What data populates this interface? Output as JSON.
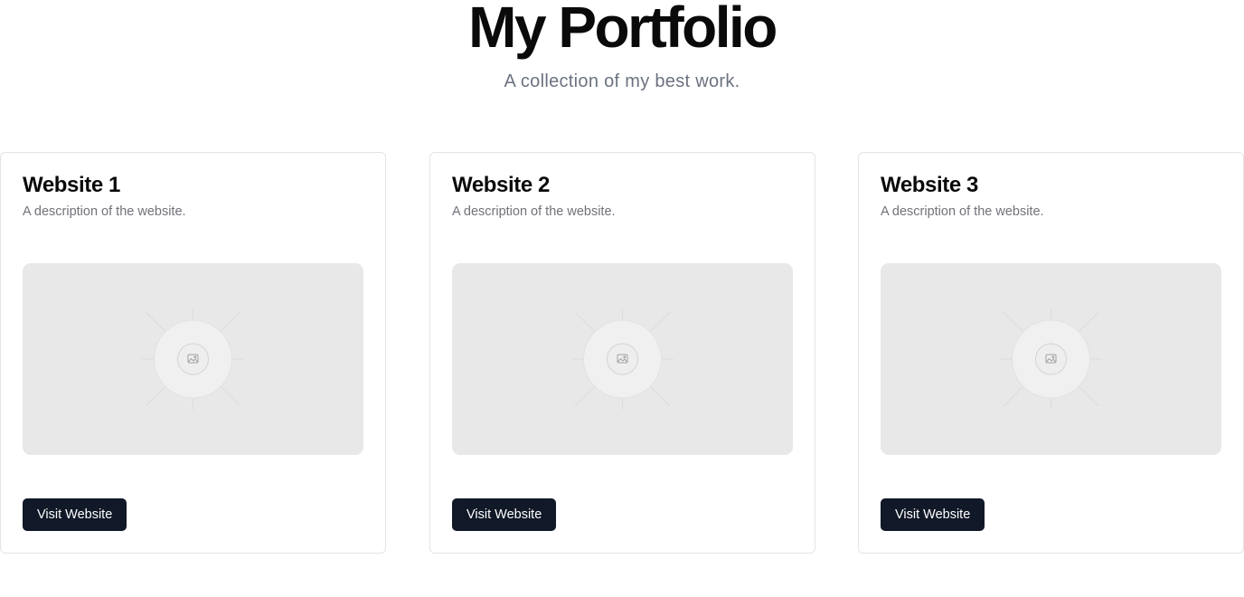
{
  "header": {
    "title": "My Portfolio",
    "subtitle": "A collection of my best work."
  },
  "cards": [
    {
      "title": "Website 1",
      "description": "A description of the website.",
      "button_label": "Visit Website",
      "image_icon": "image-placeholder-icon"
    },
    {
      "title": "Website 2",
      "description": "A description of the website.",
      "button_label": "Visit Website",
      "image_icon": "image-placeholder-icon"
    },
    {
      "title": "Website 3",
      "description": "A description of the website.",
      "button_label": "Visit Website",
      "image_icon": "image-placeholder-icon"
    }
  ],
  "colors": {
    "button_bg": "#111827",
    "placeholder_bg": "#e8e8e8",
    "muted_text": "#71717a"
  }
}
